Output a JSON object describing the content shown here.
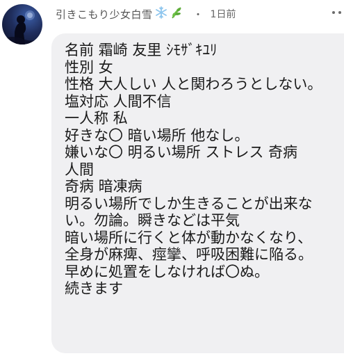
{
  "comment": {
    "username": "引きこもり少女白雪",
    "username_emojis": [
      "snowflake-icon",
      "herb-icon"
    ],
    "separator": "・",
    "timestamp": "1日前",
    "more_button_icon": "more-dots-icon",
    "avatar_icon": "user-avatar",
    "lines": [
      "名前 霜崎 友里 ｼﾓｻﾞｷﾕﾘ",
      "性別 女",
      "性格 大人しい 人と関わろうとしない。",
      "塩対応 人間不信",
      "一人称 私",
      "好きな〇 暗い場所 他なし。",
      "嫌いな〇 明るい場所 ストレス 奇病",
      "人間",
      "奇病 暗凍病",
      "明るい場所でしか生きることが出来な",
      "い。勿論。瞬きなどは平気",
      "暗い場所に行くと体が動かなくなり、",
      "全身が麻痺、痙攣、呼吸困難に陥る。",
      "早めに処置をしなければ〇ぬ。",
      "続きます"
    ]
  },
  "colors": {
    "bubble_bg": "#f0f0f2",
    "text": "#1a1a1a",
    "meta_text": "#666666",
    "snowflake": "#8fc6ee",
    "herb": "#5fae3a"
  }
}
